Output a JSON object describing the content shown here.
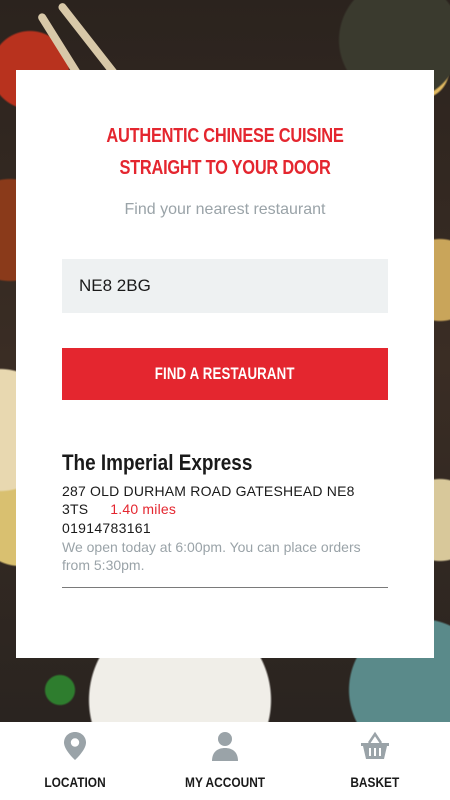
{
  "hero": {
    "headline": "AUTHENTIC CHINESE CUISINE STRAIGHT TO YOUR DOOR",
    "subtitle": "Find your nearest restaurant"
  },
  "search": {
    "postcode_value": "NE8 2BG",
    "button_label": "FIND A RESTAURANT"
  },
  "result": {
    "name": "The Imperial Express",
    "address": "287 OLD DURHAM ROAD   GATESHEAD   NE8 3TS",
    "distance": "1.40 miles",
    "phone": "01914783161",
    "opening_note": "We open today at 6:00pm. You can place orders from 5:30pm."
  },
  "nav": {
    "items": [
      {
        "label": "LOCATION",
        "icon": "location-pin-icon"
      },
      {
        "label": "MY ACCOUNT",
        "icon": "account-icon"
      },
      {
        "label": "BASKET",
        "icon": "basket-icon"
      }
    ]
  },
  "colors": {
    "accent": "#e4262f",
    "muted_text": "#9aa3a8",
    "icon_gray": "#9aa3a8"
  }
}
